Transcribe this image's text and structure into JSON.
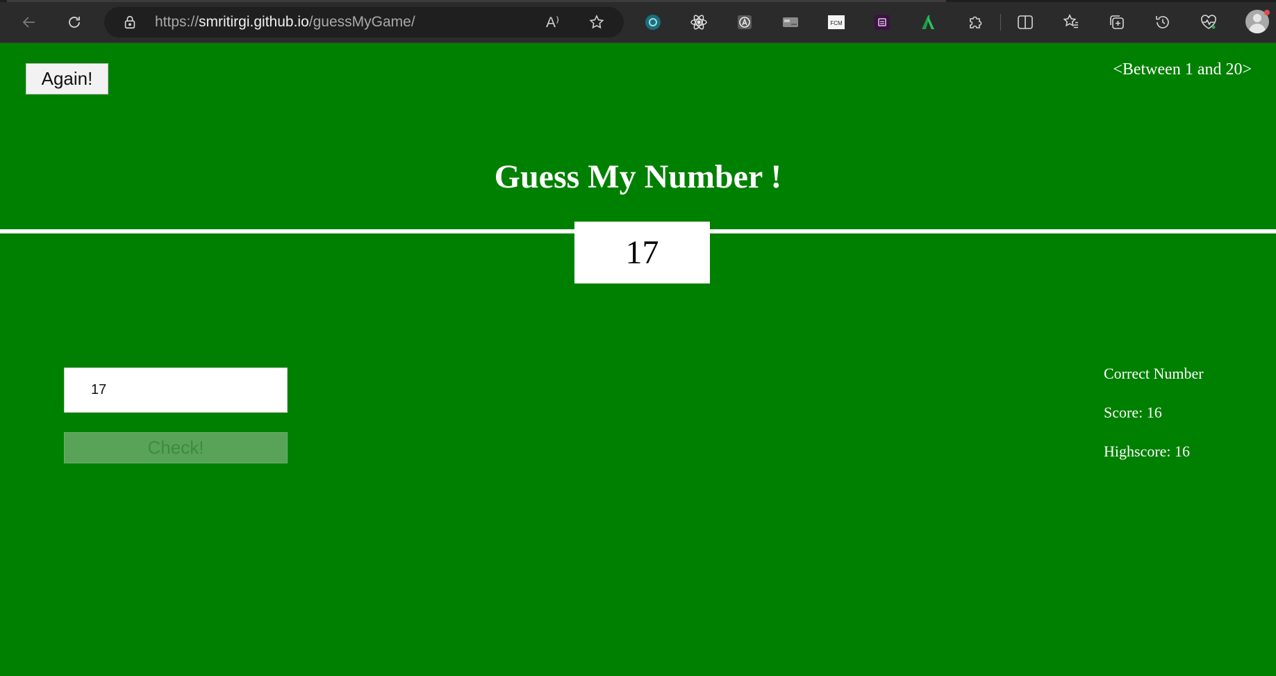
{
  "browser": {
    "url_scheme": "https://",
    "url_host": "smritirgi.github.io",
    "url_path": "/guessMyGame/",
    "read_aloud_label": "A⁾",
    "extensions": [
      "extension-teal-icon",
      "react-icon",
      "extension-circle-a-icon",
      "extension-card-icon",
      "extension-fcm-icon",
      "extension-purple-icon",
      "extension-green-a-icon",
      "puzzle-icon",
      "split-screen-icon",
      "favorites-icon",
      "collections-icon",
      "history-icon",
      "performance-icon"
    ]
  },
  "game": {
    "again_label": "Again!",
    "range_hint": "<Between 1 and 20>",
    "title": "Guess My Number !",
    "secret_number": "17",
    "guess_value": "17",
    "check_label": "Check!",
    "message": "Correct Number",
    "score_text": "Score: 16",
    "highscore_text": "Highscore: 16"
  },
  "colors": {
    "background": "#008000",
    "text": "#ffffff",
    "check_button_disabled": "#58a358"
  }
}
